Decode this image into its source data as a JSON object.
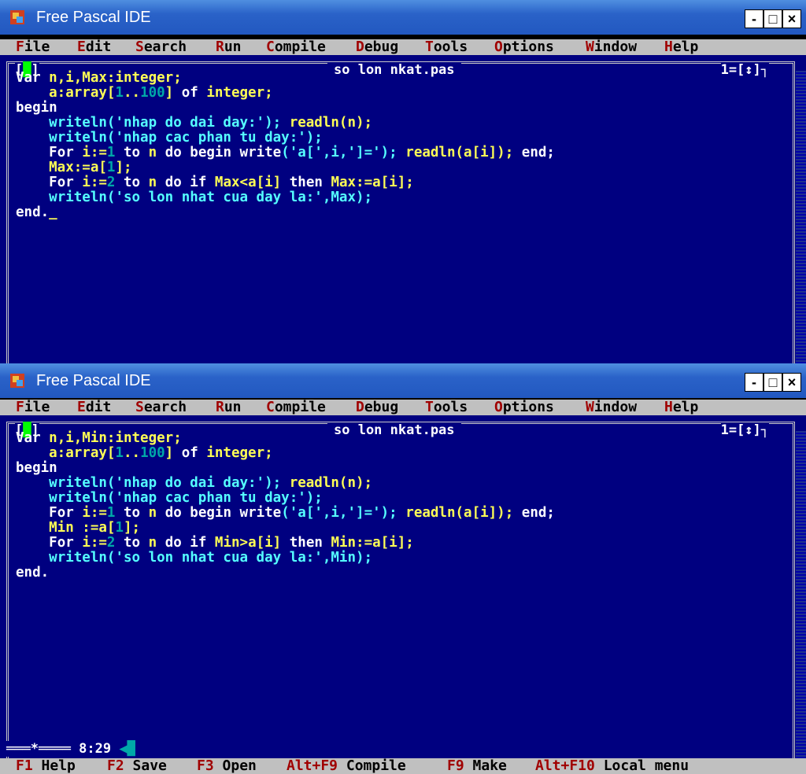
{
  "window1": {
    "title": "Free Pascal IDE",
    "file_name": "so lon nkat.pas",
    "window_number": "1=[↕]┐",
    "code_lines": [
      [
        [
          "kw",
          "Var "
        ],
        [
          "",
          "n,i,Max:integer;"
        ]
      ],
      [
        [
          "",
          "    a:array["
        ],
        [
          "n",
          "1"
        ],
        [
          "",
          "..",
          ""
        ],
        [
          "n",
          "100"
        ],
        [
          "",
          "] "
        ],
        [
          "kw",
          "of "
        ],
        [
          "",
          "integer;"
        ]
      ],
      [
        [
          "kw",
          "begin"
        ]
      ],
      [
        [
          "",
          "    "
        ],
        [
          "s",
          "writeln('nhap do dai day:'); "
        ],
        [
          "",
          "readln(n);"
        ]
      ],
      [
        [
          "",
          "    "
        ],
        [
          "s",
          "writeln('nhap cac phan tu day:');"
        ]
      ],
      [
        [
          "",
          "    "
        ],
        [
          "kw",
          "For "
        ],
        [
          "",
          "i:="
        ],
        [
          "n",
          "1"
        ],
        [
          "kw",
          " to "
        ],
        [
          "",
          "n "
        ],
        [
          "kw",
          "do begin "
        ],
        [
          "kw",
          "write"
        ],
        [
          "s",
          "('a[',i,']=');"
        ],
        [
          "",
          ""
        ],
        [
          "s",
          " "
        ],
        [
          "",
          "readln(a[i]); "
        ],
        [
          "kw",
          "end;"
        ]
      ],
      [
        [
          "",
          "    Max:=a["
        ],
        [
          "n",
          "1"
        ],
        [
          "",
          "];"
        ]
      ],
      [
        [
          "",
          "    "
        ],
        [
          "kw",
          "For "
        ],
        [
          "",
          "i:="
        ],
        [
          "n",
          "2"
        ],
        [
          "kw",
          " to "
        ],
        [
          "",
          "n "
        ],
        [
          "kw",
          "do if "
        ],
        [
          "",
          "Max<a[i] "
        ],
        [
          "kw",
          "then "
        ],
        [
          "",
          "Max:=a[i];"
        ]
      ],
      [
        [
          "",
          "    "
        ],
        [
          "s",
          "writeln('so lon nhat cua day la:',Max);"
        ]
      ],
      [
        [
          "kw",
          "end."
        ],
        [
          "",
          "_"
        ]
      ]
    ]
  },
  "window2": {
    "title": "Free Pascal IDE",
    "file_name": "so lon nkat.pas",
    "window_number": "1=[↕]┐",
    "code_lines": [
      [
        [
          "kw",
          "Var "
        ],
        [
          "",
          "n,i,Min:integer;"
        ]
      ],
      [
        [
          "",
          "    a:array["
        ],
        [
          "n",
          "1"
        ],
        [
          "",
          "..",
          ""
        ],
        [
          "n",
          "100"
        ],
        [
          "",
          "] "
        ],
        [
          "kw",
          "of "
        ],
        [
          "",
          "integer;"
        ]
      ],
      [
        [
          "kw",
          "begin"
        ]
      ],
      [
        [
          "",
          "    "
        ],
        [
          "s",
          "writeln('nhap do dai day:'); "
        ],
        [
          "",
          "readln(n);"
        ]
      ],
      [
        [
          "",
          "    "
        ],
        [
          "s",
          "writeln('nhap cac phan tu day:');"
        ]
      ],
      [
        [
          "",
          "    "
        ],
        [
          "kw",
          "For "
        ],
        [
          "",
          "i:="
        ],
        [
          "n",
          "1"
        ],
        [
          "kw",
          " to "
        ],
        [
          "",
          "n "
        ],
        [
          "kw",
          "do begin "
        ],
        [
          "kw",
          "write"
        ],
        [
          "s",
          "('a[',i,']=');"
        ],
        [
          "s",
          " "
        ],
        [
          "",
          "readln(a[i]); "
        ],
        [
          "kw",
          "end;"
        ]
      ],
      [
        [
          "",
          "    Min :=a["
        ],
        [
          "n",
          "1"
        ],
        [
          "",
          "];"
        ]
      ],
      [
        [
          "",
          "    "
        ],
        [
          "kw",
          "For "
        ],
        [
          "",
          "i:="
        ],
        [
          "n",
          "2"
        ],
        [
          "kw",
          " to "
        ],
        [
          "",
          "n "
        ],
        [
          "kw",
          "do if "
        ],
        [
          "",
          "Min>a[i] "
        ],
        [
          "kw",
          "then "
        ],
        [
          "",
          "Min:=a[i];"
        ]
      ],
      [
        [
          "",
          "    "
        ],
        [
          "s",
          "writeln('so lon nhat cua day la:',Min);"
        ]
      ],
      [
        [
          "kw",
          "end."
        ]
      ]
    ],
    "cursor_position": "8:29"
  },
  "menu": [
    {
      "hot": "F",
      "rest": "ile"
    },
    {
      "hot": "E",
      "rest": "dit"
    },
    {
      "hot": "S",
      "rest": "earch"
    },
    {
      "hot": "R",
      "rest": "un"
    },
    {
      "hot": "C",
      "rest": "ompile"
    },
    {
      "hot": "D",
      "rest": "ebug"
    },
    {
      "hot": "T",
      "rest": "ools"
    },
    {
      "hot": "O",
      "rest": "ptions"
    },
    {
      "hot": "W",
      "rest": "indow"
    },
    {
      "hot": "H",
      "rest": "elp"
    }
  ],
  "status": [
    {
      "key": "F1",
      "label": " Help"
    },
    {
      "key": "F2",
      "label": " Save"
    },
    {
      "key": "F3",
      "label": " Open"
    },
    {
      "key": "Alt+F9",
      "label": " Compile"
    },
    {
      "key": "F9",
      "label": " Make"
    },
    {
      "key": "Alt+F10",
      "label": " Local menu"
    }
  ],
  "window_buttons": {
    "minimize": "-",
    "maximize": "□",
    "close": "×"
  },
  "colors": {
    "editor_bg": "#000080",
    "titlebar": "#2a62c8",
    "menubar": "#c0c0c0",
    "hotkey": "#a00000",
    "code_text": "#ffff55",
    "keyword": "#ffffff",
    "string": "#55ffff",
    "number": "#00a8a8"
  }
}
